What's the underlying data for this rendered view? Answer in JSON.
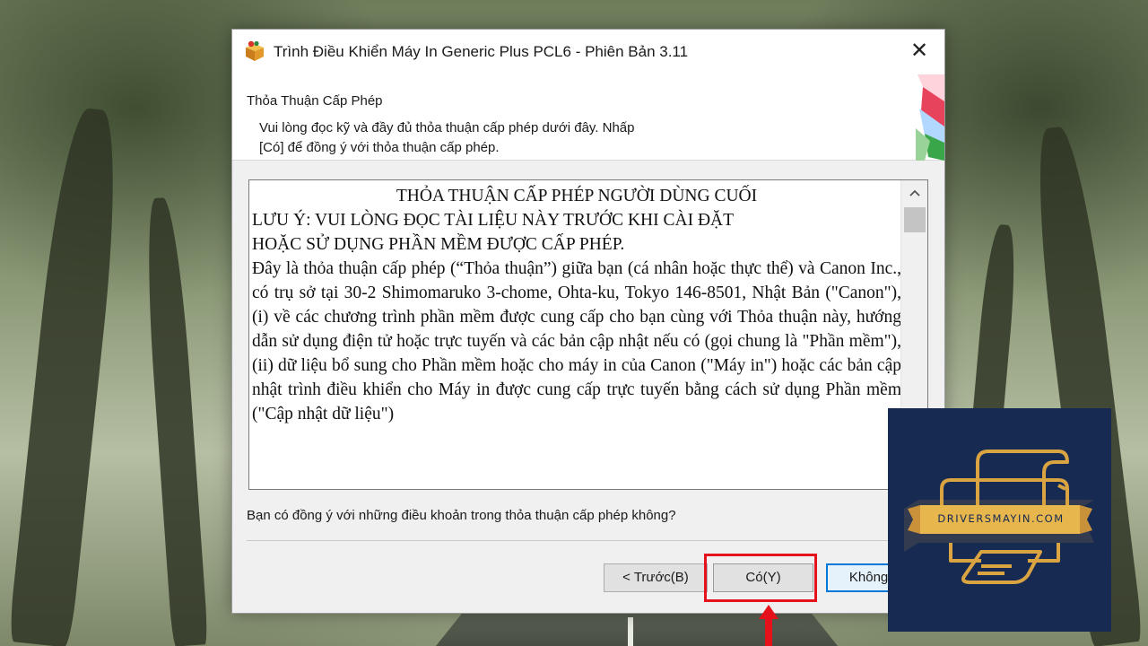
{
  "window": {
    "title": "Trình Điều Khiển Máy In Generic Plus PCL6 - Phiên Bản 3.11",
    "close_label": "✕"
  },
  "header": {
    "title": "Thỏa Thuận Cấp Phép",
    "description_line1": "Vui lòng đọc kỹ và đầy đủ thỏa thuận cấp phép dưới đây. Nhấp",
    "description_line2": "[Có] để đồng ý với thỏa thuận cấp phép."
  },
  "license": {
    "title": "THỎA THUẬN CẤP PHÉP NGƯỜI DÙNG CUỐI",
    "note_line1": "LƯU Ý: VUI LÒNG ĐỌC TÀI LIỆU NÀY TRƯỚC KHI CÀI ĐẶT",
    "note_line2": "HOẶC SỬ DỤNG PHẦN MỀM ĐƯỢC CẤP PHÉP.",
    "body": "Đây là thỏa thuận cấp phép (“Thỏa thuận”) giữa bạn (cá nhân hoặc thực thể) và Canon Inc., có trụ sở tại 30-2 Shimomaruko 3-chome, Ohta-ku, Tokyo 146-8501, Nhật Bản (\"Canon\"), (i) về các chương trình phần mềm được cung cấp cho bạn cùng với Thỏa thuận này, hướng dẫn sử dụng điện tử hoặc trực tuyến và các bản cập nhật nếu có (gọi chung là \"Phần mềm\"), (ii) dữ liệu bổ sung cho Phần mềm hoặc cho máy in của Canon (\"Máy in\") hoặc các bản cập nhật trình điều khiển cho Máy in được cung cấp trực tuyến bằng cách sử dụng Phần mềm (\"Cập nhật dữ liệu\")"
  },
  "question": "Bạn có đồng ý với những điều khoản trong thỏa thuận cấp phép không?",
  "buttons": {
    "back": "< Trước(B)",
    "yes": "Có(Y)",
    "no": "Không(N)"
  },
  "watermark": {
    "text": "DRIVERSMAYIN.COM",
    "background": "#162a52",
    "accent": "#d9a441"
  },
  "colors": {
    "highlight": "#e5121b",
    "focus_border": "#0078d7"
  },
  "icons": {
    "app": "installer-box-icon",
    "close": "close-icon",
    "scroll_up": "chevron-up-icon",
    "arrow": "arrow-up-icon"
  }
}
